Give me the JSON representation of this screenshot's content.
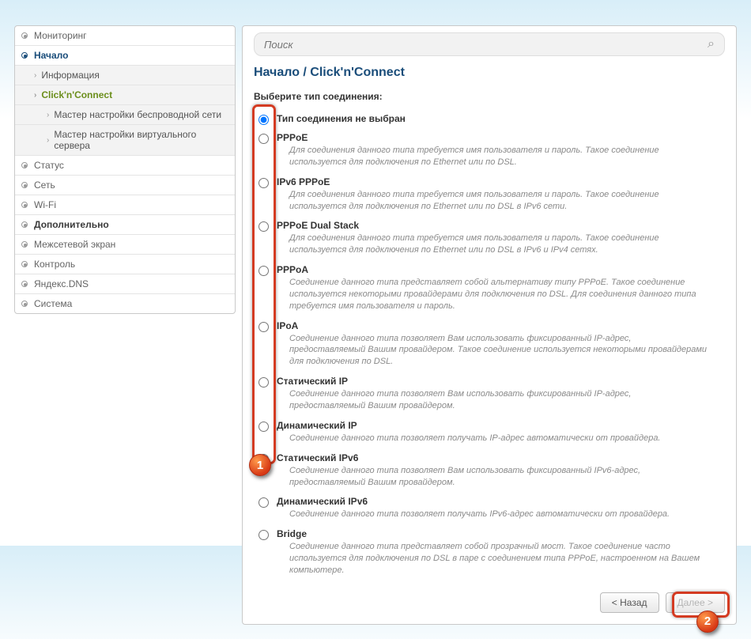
{
  "sidebar": {
    "items": [
      {
        "label": "Мониторинг",
        "type": "top"
      },
      {
        "label": "Начало",
        "type": "nachalo"
      },
      {
        "label": "Информация",
        "type": "sub"
      },
      {
        "label": "Click'n'Connect",
        "type": "sub-active"
      },
      {
        "label": "Мастер настройки беспроводной сети",
        "type": "sub2"
      },
      {
        "label": "Мастер настройки виртуального сервера",
        "type": "sub2"
      },
      {
        "label": "Статус",
        "type": "top"
      },
      {
        "label": "Сеть",
        "type": "top"
      },
      {
        "label": "Wi-Fi",
        "type": "top"
      },
      {
        "label": "Дополнительно",
        "type": "bold"
      },
      {
        "label": "Межсетевой экран",
        "type": "top"
      },
      {
        "label": "Контроль",
        "type": "top"
      },
      {
        "label": "Яндекс.DNS",
        "type": "top"
      },
      {
        "label": "Система",
        "type": "top"
      }
    ]
  },
  "search": {
    "placeholder": "Поиск"
  },
  "breadcrumb": "Начало /  Click'n'Connect",
  "prompt": "Выберите тип соединения:",
  "options": [
    {
      "title": "Тип соединения не выбран",
      "desc": "",
      "selected": true
    },
    {
      "title": "PPPoE",
      "desc": "Для соединения данного типа требуется имя пользователя и пароль. Такое соединение используется для подключения по Ethernet или по DSL."
    },
    {
      "title": "IPv6 PPPoE",
      "desc": "Для соединения данного типа требуется имя пользователя и пароль. Такое соединение используется для подключения по Ethernet или по DSL в IPv6 сети."
    },
    {
      "title": "PPPoE Dual Stack",
      "desc": "Для соединения данного типа требуется имя пользователя и пароль. Такое соединение используется для подключения по Ethernet или по DSL в IPv6 и IPv4 сетях."
    },
    {
      "title": "PPPoA",
      "desc": "Соединение данного типа представляет собой альтернативу типу PPPoE. Такое соединение используется некоторыми провайдерами для подключения по DSL. Для соединения данного типа требуется имя пользователя и пароль."
    },
    {
      "title": "IPoA",
      "desc": "Соединение данного типа позволяет Вам использовать фиксированный IP-адрес, предоставляемый Вашим провайдером. Такое соединение используется некоторыми провайдерами для подключения по DSL."
    },
    {
      "title": "Статический IP",
      "desc": "Соединение данного типа позволяет Вам использовать фиксированный IP-адрес, предоставляемый Вашим провайдером."
    },
    {
      "title": "Динамический IP",
      "desc": "Соединение данного типа позволяет получать IP-адрес автоматически от провайдера."
    },
    {
      "title": "Статический IPv6",
      "desc": "Соединение данного типа позволяет Вам использовать фиксированный IPv6-адрес, предоставляемый Вашим провайдером."
    },
    {
      "title": "Динамический IPv6",
      "desc": "Соединение данного типа позволяет получать IPv6-адрес автоматически от провайдера."
    },
    {
      "title": "Bridge",
      "desc": "Соединение данного типа представляет собой прозрачный мост. Такое соединение часто используется для подключения по DSL в паре с соединением типа PPPoE, настроенном на Вашем компьютере."
    }
  ],
  "buttons": {
    "back": "< Назад",
    "next": "Далее >"
  },
  "markers": {
    "m1": "1",
    "m2": "2"
  }
}
